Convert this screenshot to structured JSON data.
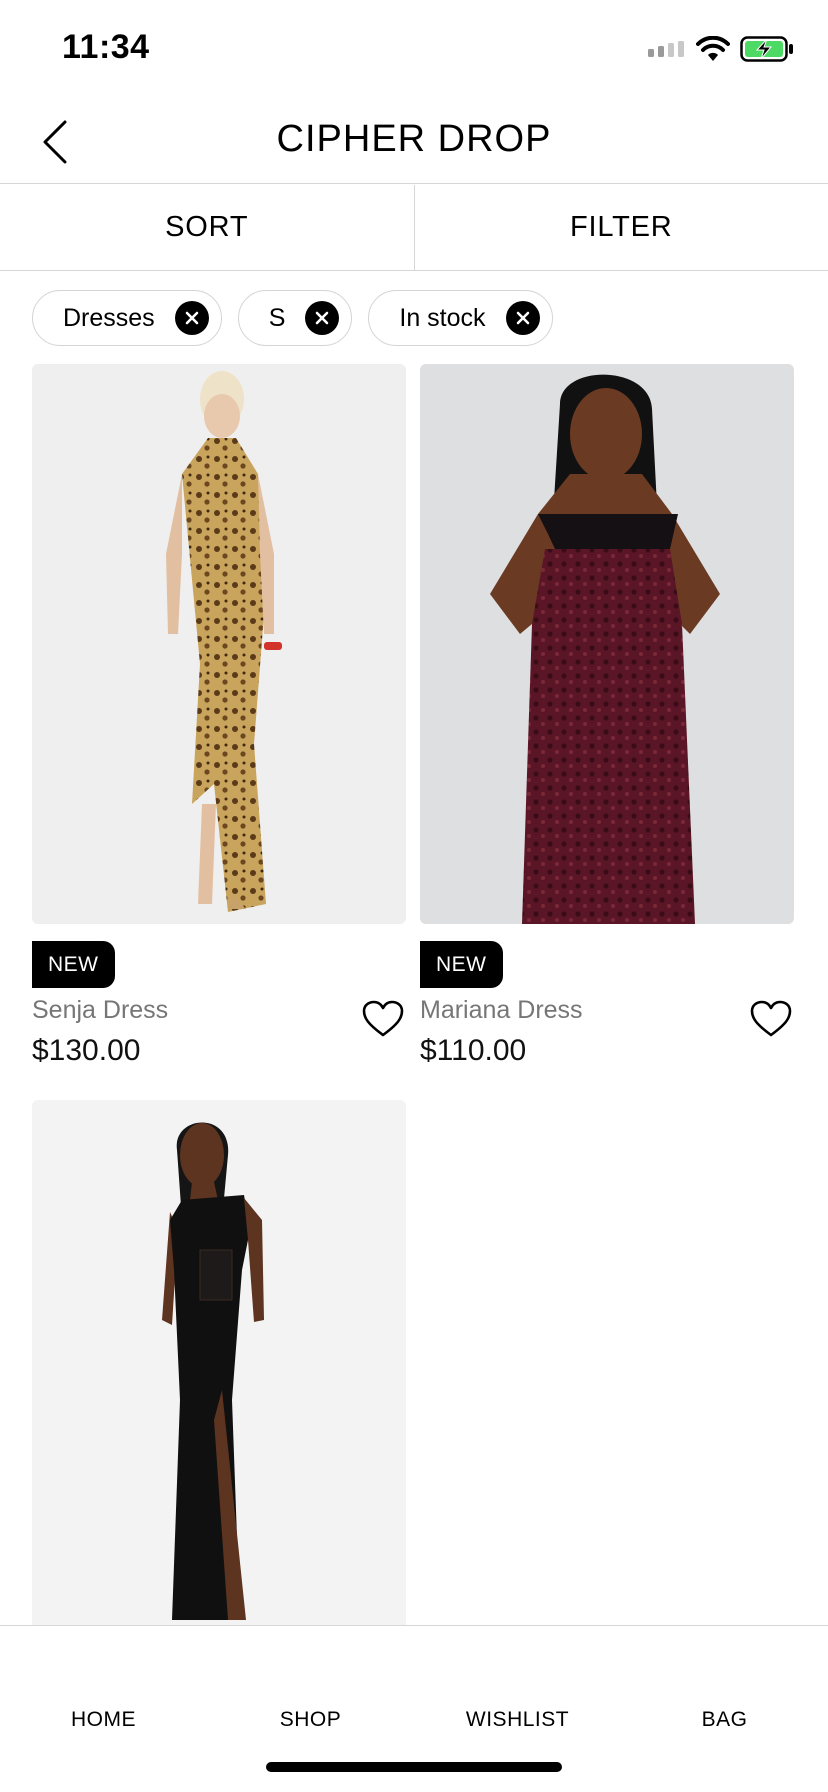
{
  "status_bar": {
    "time": "11:34"
  },
  "header": {
    "title": "CIPHER DROP"
  },
  "toolbar": {
    "sort_label": "SORT",
    "filter_label": "FILTER"
  },
  "filters": [
    {
      "label": "Dresses"
    },
    {
      "label": "S"
    },
    {
      "label": "In stock"
    }
  ],
  "products": [
    {
      "badge": "NEW",
      "name": "Senja Dress",
      "price": "$130.00",
      "image": "leopard-print-halter-dress-photo"
    },
    {
      "badge": "NEW",
      "name": "Mariana Dress",
      "price": "$110.00",
      "image": "burgundy-lace-corset-dress-photo"
    },
    {
      "badge": "",
      "name": "",
      "price": "",
      "image": "black-one-shoulder-slit-dress-photo"
    }
  ],
  "bottom_nav": [
    {
      "label": "HOME"
    },
    {
      "label": "SHOP"
    },
    {
      "label": "WISHLIST"
    },
    {
      "label": "BAG"
    }
  ],
  "colors": {
    "accent": "#000000",
    "battery": "#4cd964",
    "muted_text": "#767676",
    "divider": "#d6d6d6"
  }
}
